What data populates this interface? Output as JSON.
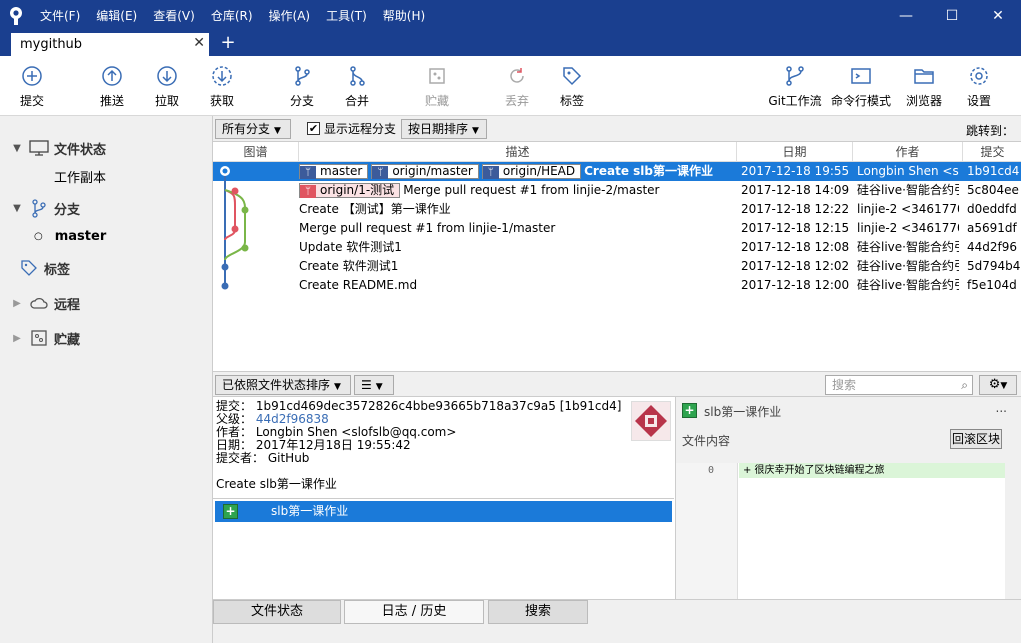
{
  "menu": [
    "文件(F)",
    "编辑(E)",
    "查看(V)",
    "仓库(R)",
    "操作(A)",
    "工具(T)",
    "帮助(H)"
  ],
  "window_controls": {
    "minimize": "—",
    "maximize": "☐",
    "close": "✕"
  },
  "repo_tab": {
    "name": "mygithub",
    "close": "✕",
    "new": "+"
  },
  "toolbar": {
    "commit": "提交",
    "push": "推送",
    "pull": "拉取",
    "fetch": "获取",
    "branch": "分支",
    "merge": "合并",
    "stash": "贮藏",
    "discard": "丢弃",
    "tag": "标签",
    "gitflow": "Git工作流",
    "terminal": "命令行模式",
    "explorer": "浏览器",
    "settings": "设置"
  },
  "sidebar": {
    "file_status": "文件状态",
    "working_copy": "工作副本",
    "branches": "分支",
    "master": "master",
    "tags": "标签",
    "remotes": "远程",
    "stashes": "贮藏"
  },
  "filter": {
    "all_branches": "所有分支",
    "show_remote": "显示远程分支",
    "show_remote_checked": "✔",
    "sort_by_date": "按日期排序",
    "jump_to": "跳转到："
  },
  "columns": {
    "graph": "图谱",
    "desc": "描述",
    "date": "日期",
    "author": "作者",
    "commit": "提交"
  },
  "commits": [
    {
      "refs": [
        "master",
        "origin/master",
        "origin/HEAD"
      ],
      "desc": "Create slb第一课作业",
      "date": "2017-12-18 19:55",
      "author": "Longbin Shen <s",
      "hash": "1b91cd4"
    },
    {
      "refs": [
        "origin/1-测试"
      ],
      "desc": "Merge pull request #1 from linjie-2/master",
      "date": "2017-12-18 14:09",
      "author": "硅谷live·智能合约引",
      "hash": "5c804ee"
    },
    {
      "refs": [],
      "desc": "Create 【测试】第一课作业",
      "date": "2017-12-18 12:22",
      "author": "linjie-2 <3461770",
      "hash": "d0eddfd"
    },
    {
      "refs": [],
      "desc": "Merge pull request #1 from linjie-1/master",
      "date": "2017-12-18 12:15",
      "author": "linjie-2 <3461770",
      "hash": "a5691df"
    },
    {
      "refs": [],
      "desc": "Update 软件测试1",
      "date": "2017-12-18 12:08",
      "author": "硅谷live·智能合约引",
      "hash": "44d2f96"
    },
    {
      "refs": [],
      "desc": "Create 软件测试1",
      "date": "2017-12-18 12:02",
      "author": "硅谷live·智能合约引",
      "hash": "5d794b4"
    },
    {
      "refs": [],
      "desc": "Create README.md",
      "date": "2017-12-18 12:00",
      "author": "硅谷live·智能合约引",
      "hash": "f5e104d"
    }
  ],
  "bottom_filter": {
    "sort": "已依照文件状态排序",
    "list_icon": "☰",
    "search_placeholder": "搜索",
    "gear": "⚙"
  },
  "commit_detail": {
    "commit_label": "提交：",
    "commit_value": "1b91cd469dec3572826c4bbe93665b718a37c9a5 [1b91cd4]",
    "parent_label": "父级：",
    "parent_value": "44d2f96838",
    "author_label": "作者：",
    "author_value": "Longbin Shen <slofslb@qq.com>",
    "date_label": "日期：",
    "date_value": "2017年12月18日 19:55:42",
    "committer_label": "提交者：",
    "committer_value": "GitHub",
    "message": "Create slb第一课作业"
  },
  "files": [
    {
      "name": "slb第一课作业",
      "status": "+"
    }
  ],
  "diff": {
    "file": "slb第一课作业",
    "more": "...",
    "content_label": "文件内容",
    "rollback": "回滚区块",
    "line_no": "0",
    "line": "+ 很庆幸开始了区块链编程之旅"
  },
  "bottom_tabs": {
    "file_status": "文件状态",
    "log": "日志 / 历史",
    "search": "搜索"
  }
}
